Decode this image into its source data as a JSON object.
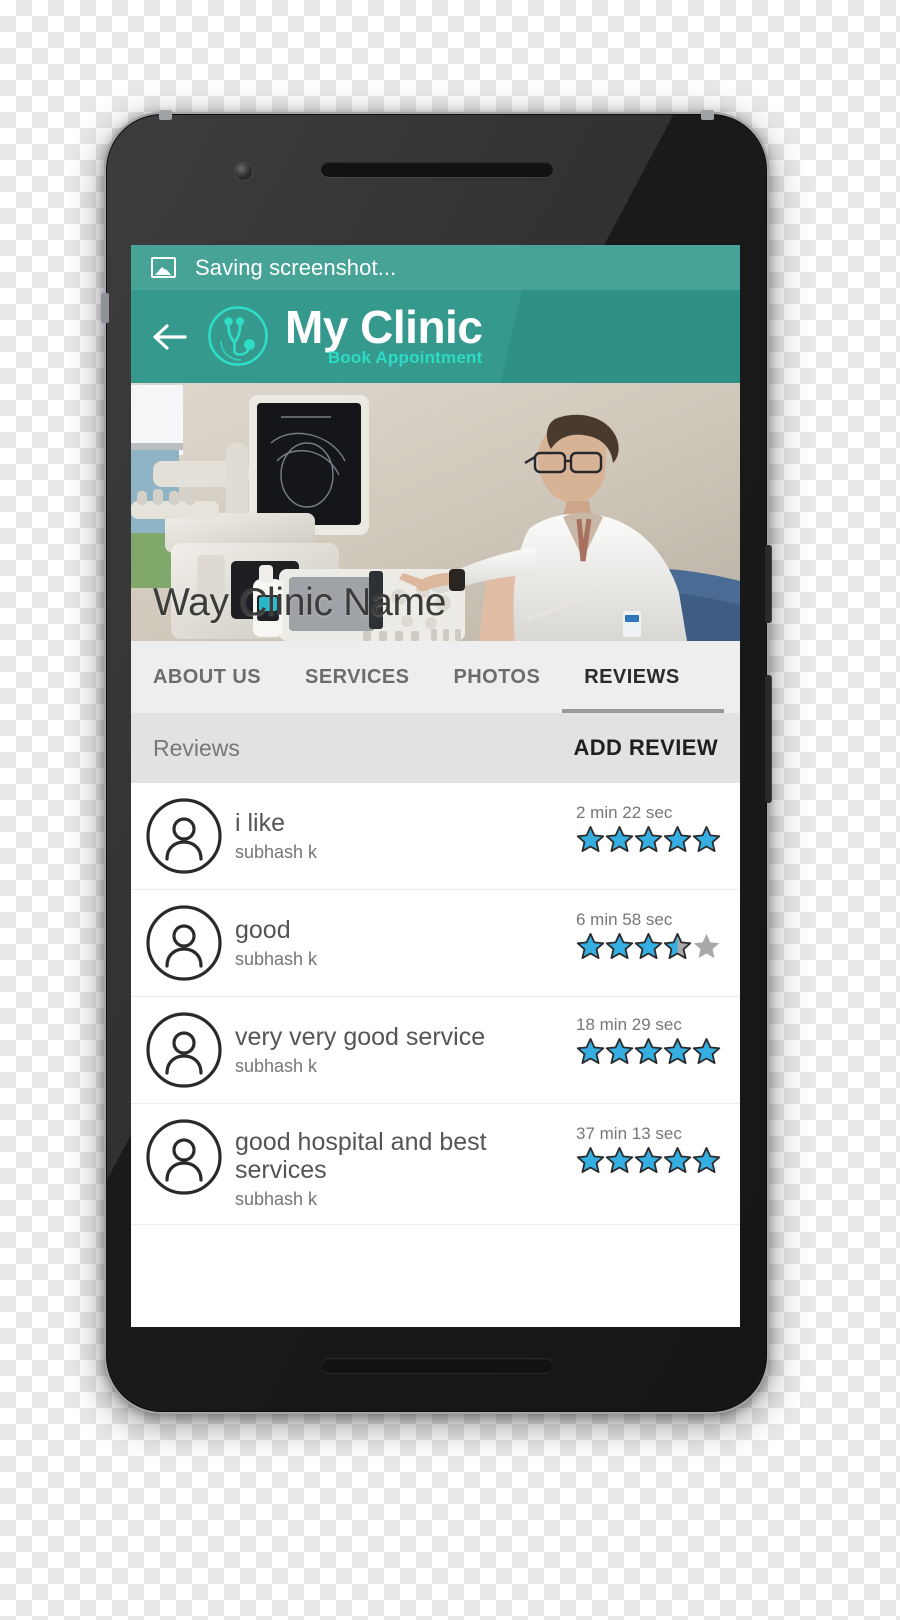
{
  "statusbar": {
    "icon": "image-icon",
    "text": "Saving screenshot..."
  },
  "appbar": {
    "back_icon": "back-arrow-icon",
    "logo_icon": "stethoscope-logo-icon",
    "title": "My Clinic",
    "subtitle": "Book Appointment",
    "bg_color": "#36998d",
    "accent_color": "#2ddbc4"
  },
  "hero": {
    "clinic_name": "Way Clinic Name",
    "image_alt": "doctor-operating-ultrasound-machine"
  },
  "tabs": [
    {
      "label": "ABOUT US",
      "active": false
    },
    {
      "label": "SERVICES",
      "active": false
    },
    {
      "label": "PHOTOS",
      "active": false
    },
    {
      "label": "REVIEWS",
      "active": true
    }
  ],
  "reviews_header": {
    "label": "Reviews",
    "add_button": "ADD REVIEW"
  },
  "reviews": [
    {
      "title": "i like",
      "author": "subhash k",
      "time": "2 min 22 sec",
      "rating": 5
    },
    {
      "title": "good",
      "author": "subhash k",
      "time": "6 min 58 sec",
      "rating": 3.5
    },
    {
      "title": "very very good service",
      "author": "subhash k",
      "time": "18 min 29 sec",
      "rating": 5
    },
    {
      "title": "good hospital and best services",
      "author": "subhash k",
      "time": "37 min 13 sec",
      "rating": 5
    }
  ],
  "colors": {
    "star_filled": "#35aee2",
    "star_empty": "#a7a9ab",
    "star_outline": "#2b2b2b",
    "tab_active": "#2b2b2b",
    "tab_inactive": "#6c6c6c"
  }
}
